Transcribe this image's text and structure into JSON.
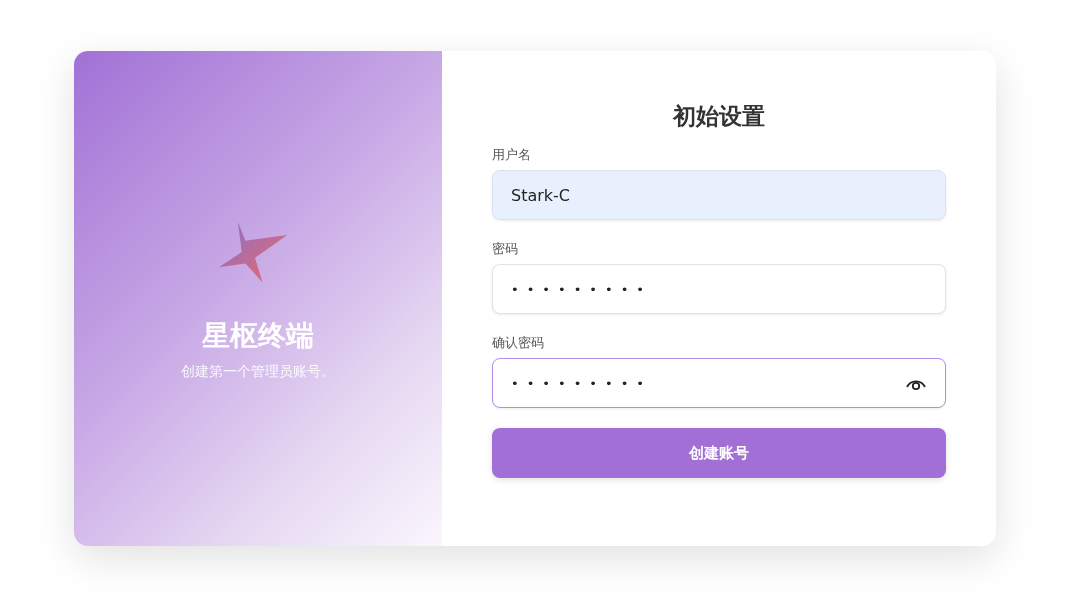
{
  "brand": {
    "name": "星枢终端",
    "tagline": "创建第一个管理员账号。"
  },
  "form": {
    "title": "初始设置",
    "fields": [
      {
        "label": "用户名",
        "value": "Stark-C",
        "autofilled": true,
        "focused": false,
        "show_toggle": false
      },
      {
        "label": "密码",
        "value": "•••••••••",
        "autofilled": false,
        "focused": false,
        "show_toggle": false
      },
      {
        "label": "确认密码",
        "value": "•••••••••",
        "autofilled": false,
        "focused": true,
        "show_toggle": true
      }
    ],
    "submit": "创建账号"
  }
}
